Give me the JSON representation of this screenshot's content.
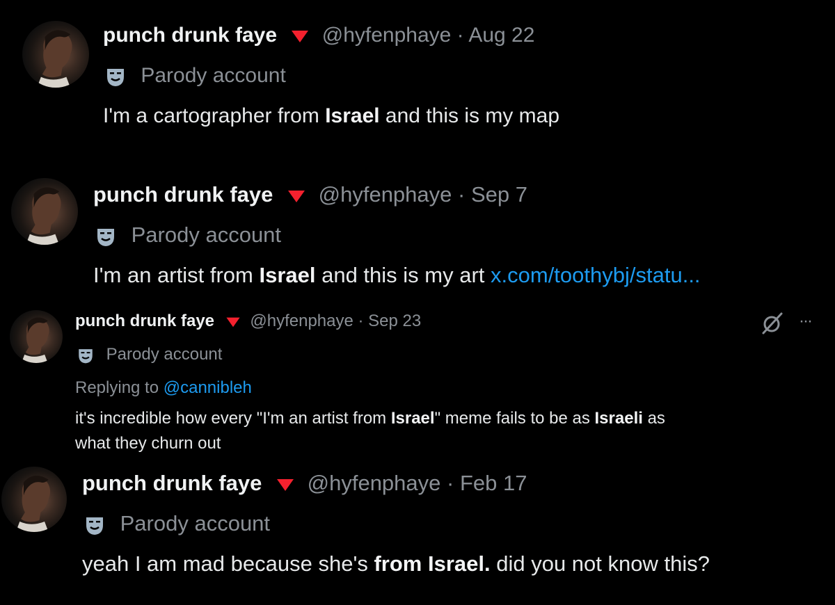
{
  "posts": [
    {
      "display_name": "punch drunk faye",
      "handle_date": "@hyfenphaye · Aug 22",
      "label": "Parody account",
      "text_before": "I'm a cartographer from ",
      "text_bold": "Israel",
      "text_after": " and this is my map"
    },
    {
      "display_name": "punch drunk faye",
      "handle_date": "@hyfenphaye · Sep 7",
      "label": "Parody account",
      "text_before": "I'm an artist from ",
      "text_bold": "Israel",
      "text_after": " and this is my art ",
      "link": "x.com/toothybj/statu..."
    },
    {
      "display_name": "punch drunk faye",
      "handle_date": "@hyfenphaye · Sep 23",
      "label": "Parody account",
      "replying_prefix": "Replying to ",
      "replying_handle": "@cannibleh",
      "line1_before": "it's incredible how every \"I'm an artist from ",
      "line1_bold": "Israel",
      "line1_mid": "\" meme fails to be as ",
      "line1_bold2": "Israeli",
      "line1_after": " as",
      "line2": "what they churn out",
      "more": "···"
    },
    {
      "display_name": "punch drunk faye",
      "handle_date": "@hyfenphaye · Feb 17",
      "label": "Parody account",
      "text_before": "yeah I am mad because she's ",
      "text_bold": "from Israel.",
      "text_after": " did you not know this?"
    }
  ],
  "colors": {
    "background": "#000000",
    "triangle": "#f4212e",
    "link": "#1d9bf0",
    "muted": "#8b9096"
  },
  "icons": [
    "triangle-down-icon",
    "parody-mask-icon",
    "grok-icon",
    "more-icon"
  ]
}
